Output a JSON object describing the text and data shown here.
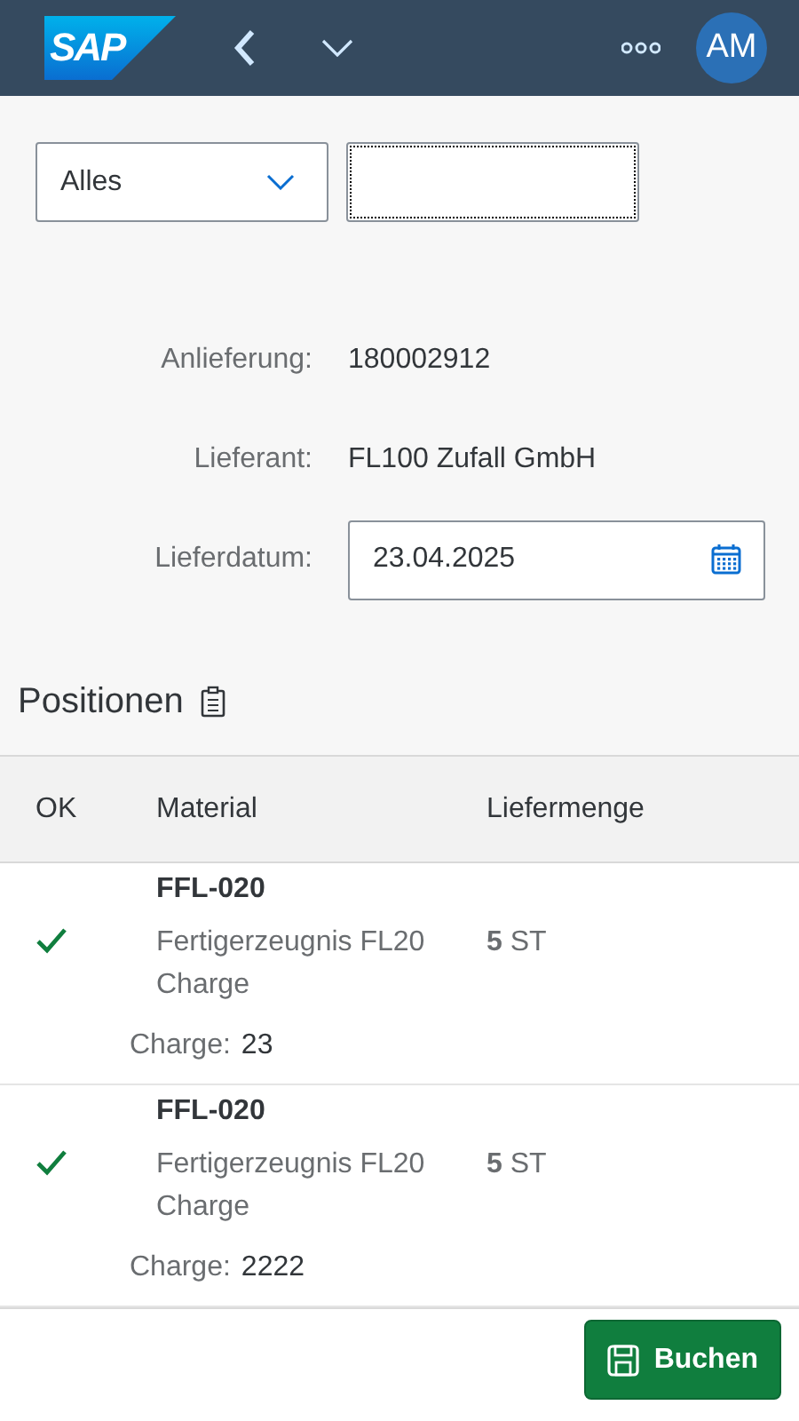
{
  "header": {
    "logo": "SAP",
    "avatar": "AM"
  },
  "filter": {
    "select_value": "Alles"
  },
  "form": [
    {
      "kind": "text",
      "label": "Anlieferung:",
      "value": "180002912"
    },
    {
      "kind": "text",
      "label": "Lieferant:",
      "value": "FL100 Zufall GmbH"
    },
    {
      "kind": "date",
      "label": "Lieferdatum:",
      "value": "23.04.2025"
    }
  ],
  "section_title": "Positionen",
  "table": {
    "columns": [
      "OK",
      "Material",
      "Liefermenge"
    ],
    "rows": [
      {
        "ok": true,
        "material": "FFL-020",
        "description": "Fertigerzeugnis FL20 Charge",
        "quantity": "5",
        "unit": "ST",
        "batch_label": "Charge:",
        "batch": "23"
      },
      {
        "ok": true,
        "material": "FFL-020",
        "description": "Fertigerzeugnis FL20 Charge",
        "quantity": "5",
        "unit": "ST",
        "batch_label": "Charge:",
        "batch": "2222"
      }
    ]
  },
  "footer": {
    "button": "Buchen"
  }
}
